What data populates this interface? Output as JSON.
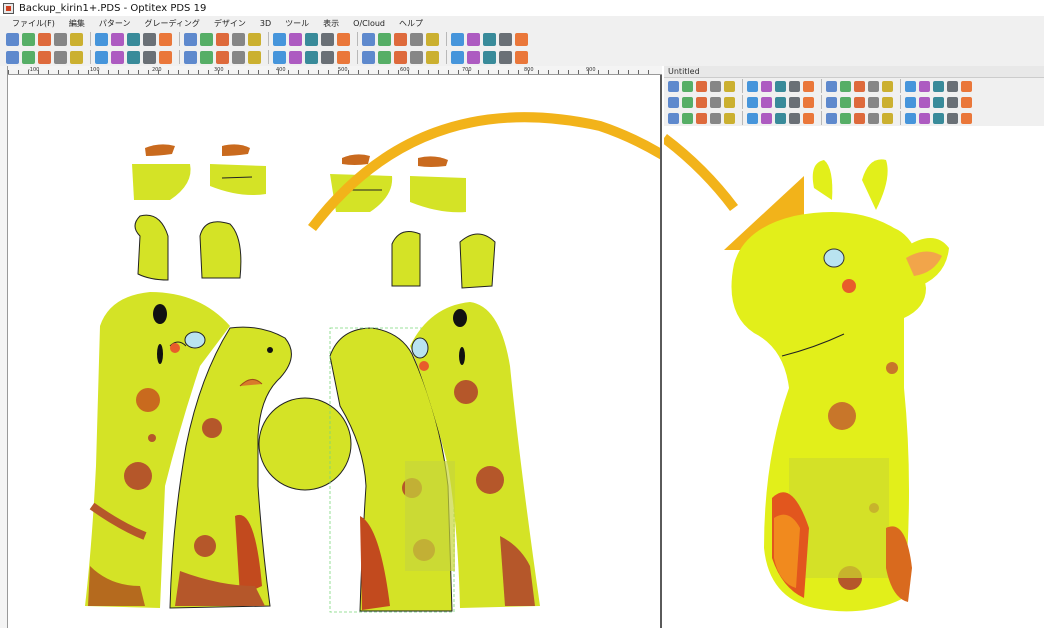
{
  "window": {
    "title": "Backup_kirin1+.PDS - Optitex PDS 19"
  },
  "menu": [
    "ファイル(F)",
    "編集",
    "パターン",
    "グレーディング",
    "デザイン",
    "3D",
    "ツール",
    "表示",
    "O/Cloud",
    "ヘルプ"
  ],
  "toolbar_icons": [
    "arrow-icon",
    "new-icon",
    "open-icon",
    "save-icon",
    "print-icon",
    "grid-icon",
    "export-icon",
    "import-icon",
    "zoom-icon",
    "undo-icon",
    "redo-icon",
    "cut-icon",
    "copy-icon",
    "paste-icon",
    "table-icon",
    "measure-icon",
    "point-icon",
    "line-icon",
    "pen-icon",
    "notch-icon",
    "stitch-icon",
    "curve-icon",
    "rotate-icon",
    "mirror-icon",
    "sew-icon",
    "seam-icon",
    "pleat-icon",
    "dart-icon",
    "fold-icon",
    "label-icon"
  ],
  "toolbar2_icons": [
    "piece-icon",
    "align-icon",
    "circle-icon",
    "rect-icon",
    "shape-icon",
    "fill-icon",
    "layer-icon",
    "group-icon",
    "lock-icon",
    "color-icon",
    "plot-icon",
    "nest-icon",
    "marker-icon",
    "size-icon",
    "rule-icon",
    "text-icon",
    "filter-icon",
    "check-icon",
    "info-icon",
    "help-icon",
    "tile-icon",
    "split-icon",
    "merge-icon",
    "offset-icon",
    "trace-icon",
    "scale-icon",
    "flip-icon",
    "pin-icon",
    "hand-icon",
    "wave-icon"
  ],
  "ruler": {
    "labels": [
      "-100",
      "100",
      "200",
      "300",
      "400",
      "500",
      "600",
      "700",
      "800",
      "900"
    ]
  },
  "panel": {
    "title": "Untitled"
  },
  "colors": {
    "fabric": "#d4e326",
    "arrow": "#f2b31a",
    "accent_orange": "#c96a1e",
    "flower": "#b5572a",
    "toolbar_bg": "#f0f0f0"
  }
}
